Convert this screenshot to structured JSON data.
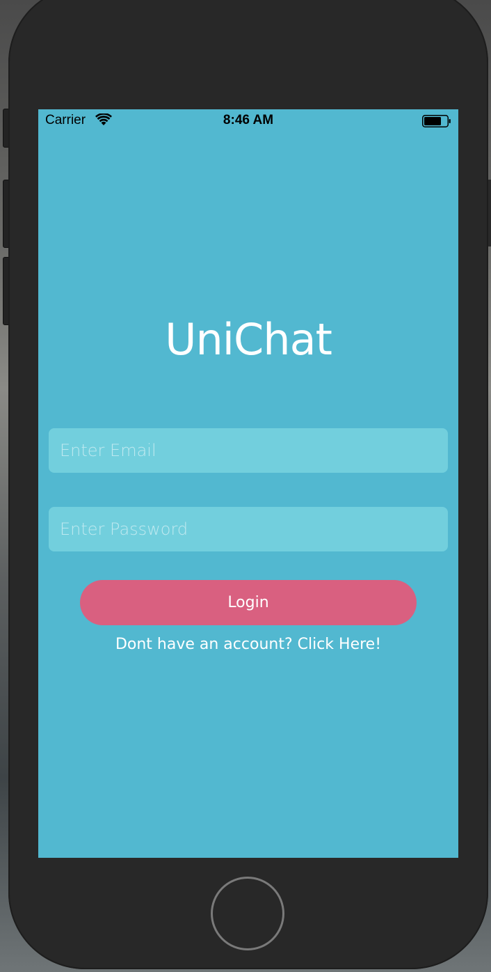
{
  "status_bar": {
    "carrier": "Carrier",
    "time": "8:46 AM",
    "wifi_icon": "wifi-icon",
    "battery_icon": "battery-icon"
  },
  "app": {
    "title": "UniChat"
  },
  "form": {
    "email_placeholder": "Enter Email",
    "email_value": "",
    "password_placeholder": "Enter Password",
    "password_value": "",
    "login_label": "Login",
    "signup_text": "Dont have an account? Click Here!"
  },
  "colors": {
    "background": "#52b8d0",
    "field": "#72cfdd",
    "login_button": "#d96080",
    "device_frame": "#282828"
  },
  "device": {
    "home_button_icon": "home-button"
  }
}
